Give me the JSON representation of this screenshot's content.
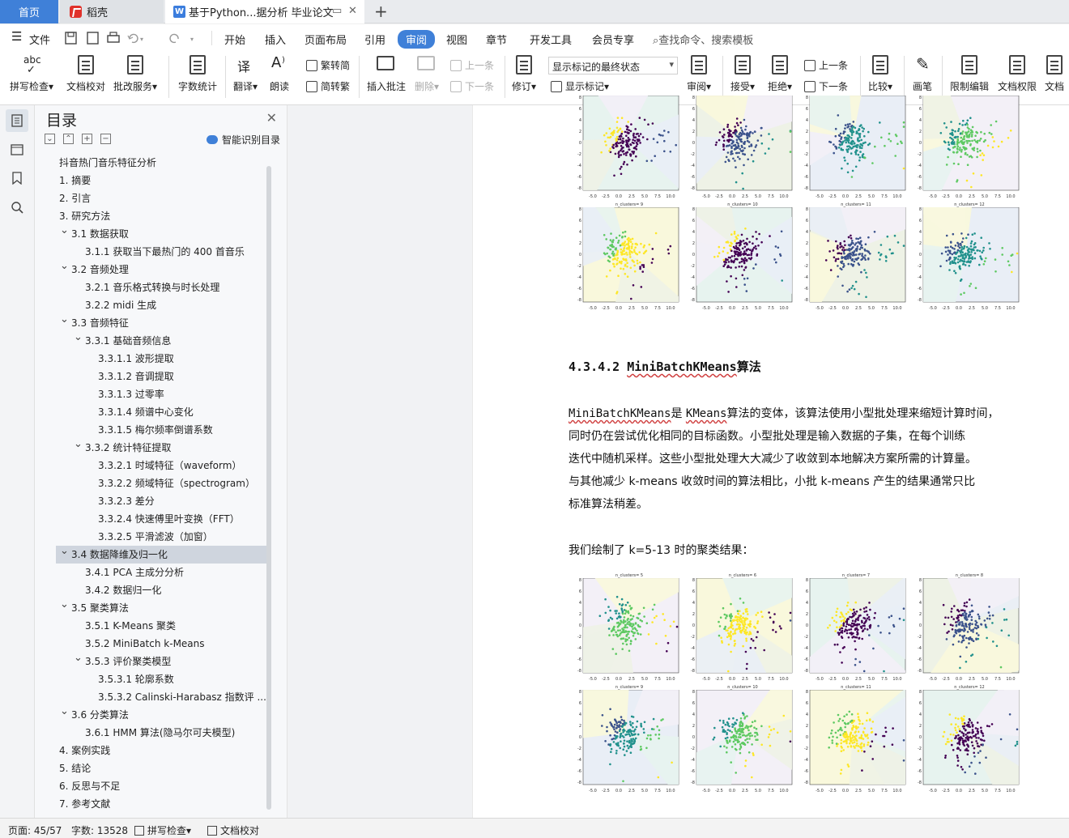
{
  "tabs": {
    "home": "首页",
    "daoke": "稻壳",
    "doc": "基于Python...据分析 毕业论文"
  },
  "menu": {
    "file": "文件",
    "items": [
      "开始",
      "插入",
      "页面布局",
      "引用",
      "审阅",
      "视图",
      "章节",
      "开发工具",
      "会员专享"
    ],
    "search": "查找命令、搜索模板"
  },
  "ribbon": {
    "spell": "拼写检查",
    "proofread": "文档校对",
    "correct_service": "批改服务",
    "word_count": "字数统计",
    "translate": "翻译",
    "read_aloud": "朗读",
    "trad": "繁转简",
    "simp": "简转繁",
    "insert_comment": "插入批注",
    "delete": "删除",
    "prev_comment": "上一条",
    "next_comment": "下一条",
    "revise": "修订",
    "markup_select": "显示标记的最终状态",
    "show_markup": "显示标记",
    "review": "审阅",
    "accept": "接受",
    "reject": "拒绝",
    "prev": "上一条",
    "next": "下一条",
    "compare": "比较",
    "pen": "画笔",
    "restrict_edit": "限制编辑",
    "doc_permission": "文档权限",
    "doc_cut": "文档"
  },
  "toc": {
    "title": "目录",
    "smart": "智能识别目录",
    "items": [
      {
        "text": "抖音热门音乐特征分析",
        "level": 0,
        "chev": ""
      },
      {
        "text": "1.  摘要",
        "level": 0,
        "chev": ""
      },
      {
        "text": "2.  引言",
        "level": 0,
        "chev": ""
      },
      {
        "text": "3.  研究方法",
        "level": 0,
        "chev": "v"
      },
      {
        "text": "3.1  数据获取",
        "level": 1,
        "chev": "v"
      },
      {
        "text": "3.1.1  获取当下最热门的 400 首音乐",
        "level": 2,
        "chev": ""
      },
      {
        "text": "3.2  音频处理",
        "level": 1,
        "chev": "v"
      },
      {
        "text": "3.2.1  音乐格式转换与时长处理",
        "level": 2,
        "chev": ""
      },
      {
        "text": "3.2.2 midi 生成",
        "level": 2,
        "chev": ""
      },
      {
        "text": "3.3  音频特征",
        "level": 1,
        "chev": "v"
      },
      {
        "text": "3.3.1  基础音频信息",
        "level": 2,
        "chev": "v"
      },
      {
        "text": "3.3.1.1  波形提取",
        "level": 3,
        "chev": ""
      },
      {
        "text": "3.3.1.2  音调提取",
        "level": 3,
        "chev": ""
      },
      {
        "text": "3.3.1.3  过零率",
        "level": 3,
        "chev": ""
      },
      {
        "text": "3.3.1.4  频谱中心变化",
        "level": 3,
        "chev": ""
      },
      {
        "text": "3.3.1.5  梅尔频率倒谱系数",
        "level": 3,
        "chev": ""
      },
      {
        "text": "3.3.2  统计特征提取",
        "level": 2,
        "chev": "v"
      },
      {
        "text": "3.3.2.1  时域特征（waveform）",
        "level": 3,
        "chev": ""
      },
      {
        "text": "3.3.2.2  频域特征（spectrogram）",
        "level": 3,
        "chev": ""
      },
      {
        "text": "3.3.2.3  差分",
        "level": 3,
        "chev": ""
      },
      {
        "text": "3.3.2.4  快速傅里叶变换（FFT）",
        "level": 3,
        "chev": ""
      },
      {
        "text": "3.3.2.5  平滑滤波（加窗）",
        "level": 3,
        "chev": ""
      },
      {
        "text": "3.4  数据降维及归一化",
        "level": 1,
        "chev": "v",
        "selected": true
      },
      {
        "text": "3.4.1 PCA 主成分分析",
        "level": 2,
        "chev": ""
      },
      {
        "text": "3.4.2  数据归一化",
        "level": 2,
        "chev": ""
      },
      {
        "text": "3.5  聚类算法",
        "level": 1,
        "chev": "v"
      },
      {
        "text": "3.5.1 K-Means 聚类",
        "level": 2,
        "chev": ""
      },
      {
        "text": "3.5.2 MiniBatch k-Means",
        "level": 2,
        "chev": ""
      },
      {
        "text": "3.5.3  评价聚类模型",
        "level": 2,
        "chev": "v"
      },
      {
        "text": "3.5.3.1  轮廓系数",
        "level": 3,
        "chev": ""
      },
      {
        "text": "3.5.3.2 Calinski-Harabasz 指数评 ...",
        "level": 3,
        "chev": ""
      },
      {
        "text": "3.6  分类算法",
        "level": 1,
        "chev": "v"
      },
      {
        "text": "3.6.1 HMM 算法(隐马尔可夫模型)",
        "level": 2,
        "chev": ""
      },
      {
        "text": "4.  案例实践",
        "level": 0,
        "chev": ">"
      },
      {
        "text": "5.  结论",
        "level": 0,
        "chev": ""
      },
      {
        "text": "6.  反思与不足",
        "level": 0,
        "chev": ""
      },
      {
        "text": "7.  参考文献",
        "level": 0,
        "chev": ""
      }
    ]
  },
  "document": {
    "heading": "4.3.4.2 MiniBatchKMeans算法",
    "para1_lines": [
      [
        "MiniBatchKMeans",
        "是 ",
        "KMeans",
        "算法的变体，该算法使用小型批处理来缩短计算时间，"
      ],
      [
        "同时仍在尝试优化相同的目标函数。小型批处理是输入数据的子集，在每个训练"
      ],
      [
        "迭代中随机采样。这些小型批处理大大减少了收敛到本地解决方案所需的计算量。"
      ],
      [
        "与其他减少 k-means 收敛时间的算法相比，小批 k-means 产生的结果通常只比"
      ],
      [
        "标准算法稍差。"
      ]
    ],
    "para2": "我们绘制了 k=5-13 时的聚类结果：",
    "top_grid_titles": [
      "",
      "",
      "",
      "",
      "n_clusters= 9",
      "n_clusters= 10",
      "n_clusters= 11",
      "n_clusters= 12"
    ],
    "bottom_grid_titles": [
      "n_clusters= 5",
      "n_clusters= 6",
      "n_clusters= 7",
      "n_clusters= 8",
      "n_clusters= 9",
      "n_clusters= 10",
      "n_clusters= 11",
      "n_clusters= 12"
    ],
    "x_ticks": [
      "-5.0",
      "-2.5",
      "0.0",
      "2.5",
      "5.0",
      "7.5",
      "10.0"
    ],
    "y_ticks": [
      "8",
      "6",
      "4",
      "2",
      "0",
      "-2",
      "-4",
      "-6",
      "-8"
    ],
    "colors": [
      "#440154",
      "#3b528b",
      "#21918c",
      "#5ec962",
      "#fde725"
    ]
  },
  "status": {
    "page": "页面: 45/57",
    "words": "字数: 13528",
    "spell": "拼写检查",
    "proof": "文档校对"
  }
}
